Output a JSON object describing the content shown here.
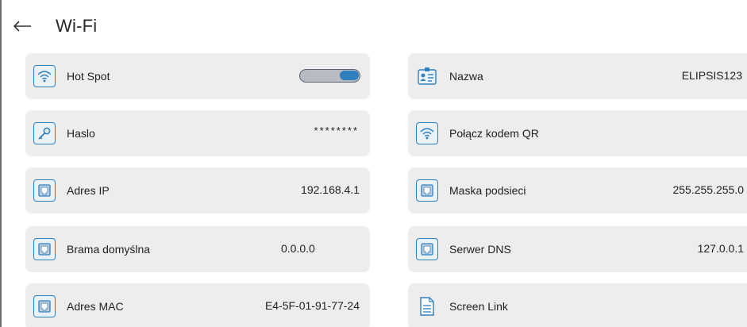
{
  "header": {
    "back_icon": "arrow-left-icon",
    "title": "Wi-Fi"
  },
  "colors": {
    "accent": "#2f7fc1",
    "card_background": "#ededed"
  },
  "items": {
    "hot_spot": {
      "label": "Hot Spot",
      "icon": "wifi-icon",
      "toggle_on": true
    },
    "nazwa": {
      "label": "Nazwa",
      "value": "ELIPSIS123",
      "icon": "id-card-icon"
    },
    "haslo": {
      "label": "Haslo",
      "value": "********",
      "icon": "key-icon"
    },
    "polacz_qr": {
      "label": "Połącz kodem QR",
      "icon": "wifi-icon"
    },
    "adres_ip": {
      "label": "Adres IP",
      "value": "192.168.4.1",
      "icon": "network-port-icon"
    },
    "maska": {
      "label": "Maska podsieci",
      "value": "255.255.255.0",
      "icon": "network-port-icon"
    },
    "brama": {
      "label": "Brama domyślna",
      "value": "0.0.0.0",
      "icon": "network-port-icon"
    },
    "dns": {
      "label": "Serwer DNS",
      "value": "127.0.0.1",
      "icon": "network-port-icon"
    },
    "mac": {
      "label": "Adres MAC",
      "value": "E4-5F-01-91-77-24",
      "icon": "network-port-icon"
    },
    "screen_link": {
      "label": "Screen Link",
      "icon": "document-icon"
    }
  }
}
